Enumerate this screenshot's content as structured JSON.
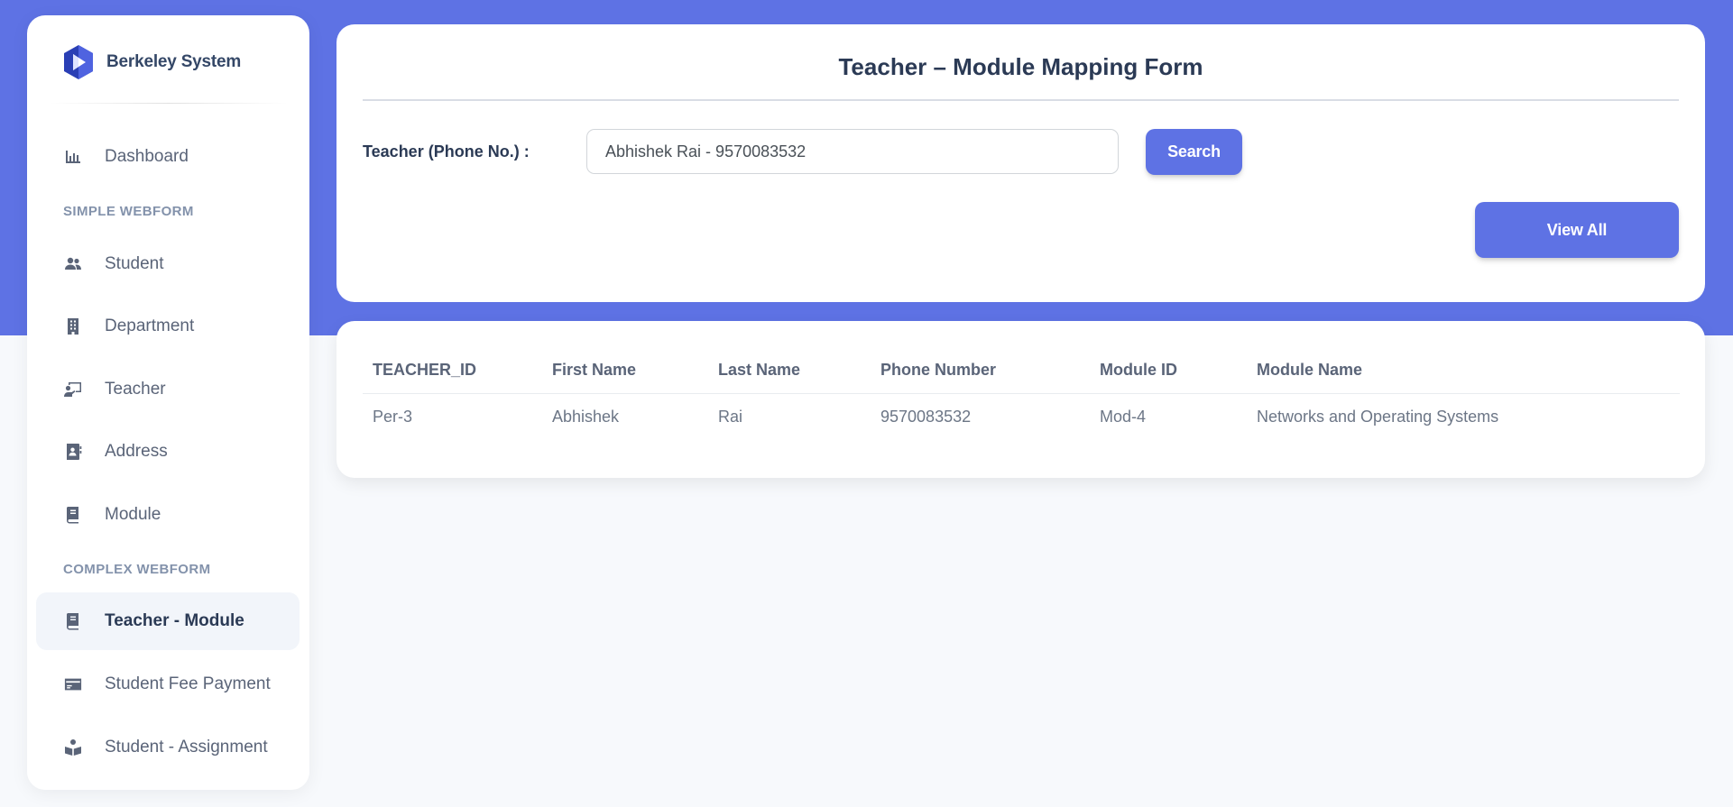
{
  "brand": {
    "name": "Berkeley System",
    "icon": "hexagon-logo-icon"
  },
  "colors": {
    "primary": "#5e72e4",
    "sidebar_bg": "#ffffff",
    "page_bg": "#f7f9fc",
    "active_item_bg": "#f2f5fa"
  },
  "sidebar": {
    "items": [
      {
        "label": "Dashboard",
        "icon": "bar-chart-icon"
      },
      {
        "label": "Student",
        "icon": "users-icon"
      },
      {
        "label": "Department",
        "icon": "building-icon"
      },
      {
        "label": "Teacher",
        "icon": "teacher-board-icon"
      },
      {
        "label": "Address",
        "icon": "address-book-icon"
      },
      {
        "label": "Module",
        "icon": "book-icon"
      },
      {
        "label": "Teacher - Module",
        "icon": "book-icon",
        "active": true
      },
      {
        "label": "Student Fee Payment",
        "icon": "credit-card-icon"
      },
      {
        "label": "Student - Assignment",
        "icon": "reading-icon"
      }
    ],
    "sections": {
      "simple": "SIMPLE WEBFORM",
      "complex": "COMPLEX WEBFORM"
    }
  },
  "form": {
    "title": "Teacher – Module Mapping Form",
    "teacher_label": "Teacher (Phone No.) :",
    "teacher_value": "Abhishek Rai - 9570083532",
    "search_label": "Search",
    "view_all_label": "View All"
  },
  "table": {
    "headers": [
      "TEACHER_ID",
      "First Name",
      "Last Name",
      "Phone Number",
      "Module ID",
      "Module Name"
    ],
    "rows": [
      [
        "Per-3",
        "Abhishek",
        "Rai",
        "9570083532",
        "Mod-4",
        "Networks and Operating Systems"
      ]
    ]
  }
}
